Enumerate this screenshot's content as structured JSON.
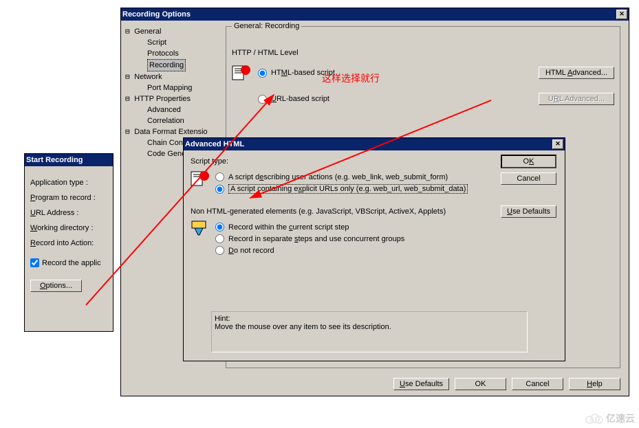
{
  "start_recording": {
    "title": "Start Recording",
    "app_type_label": "Application type :",
    "program_label": "Program to record :",
    "url_label": "URL Address :",
    "workdir_label": "Working directory :",
    "action_label": "Record into Action:",
    "record_app_checkbox": "Record the applic",
    "options_btn": "Options..."
  },
  "recording_options": {
    "title": "Recording Options",
    "tree": {
      "general": "General",
      "script": "Script",
      "protocols": "Protocols",
      "recording": "Recording",
      "network": "Network",
      "port_mapping": "Port Mapping",
      "http_props": "HTTP Properties",
      "advanced": "Advanced",
      "correlation": "Correlation",
      "data_format": "Data Format Extensio",
      "chain_config": "Chain Configuratio",
      "code_gen": "Code Generation"
    },
    "panel_title": "General: Recording",
    "http_level_label": "HTTP / HTML Level",
    "html_radio": "HTML-based script",
    "url_radio": "URL-based script",
    "html_adv_btn": "HTML Advanced...",
    "url_adv_btn": "URL Advanced...",
    "use_defaults_btn": "Use Defaults",
    "ok_btn": "OK",
    "cancel_btn": "Cancel",
    "help_btn": "Help"
  },
  "advanced_html": {
    "title": "Advanced HTML",
    "script_type_label": "Script type:",
    "radio_user_actions": "A script describing user actions (e.g. web_link, web_submit_form)",
    "radio_explicit": "A script containing explicit URLs only (e.g. web_url, web_submit_data)",
    "non_html_label": "Non HTML-generated elements (e.g. JavaScript, VBScript, ActiveX, Applets)",
    "radio_record_current": "Record within the current script step",
    "radio_record_separate": "Record in separate steps and use concurrent groups",
    "radio_do_not": "Do not record",
    "hint_label": "Hint:",
    "hint_text": "Move the mouse over any item to see its description.",
    "ok_btn": "OK",
    "cancel_btn": "Cancel",
    "use_defaults_btn": "Use Defaults"
  },
  "annotation_text": "这样选择就行",
  "watermark": "亿速云"
}
